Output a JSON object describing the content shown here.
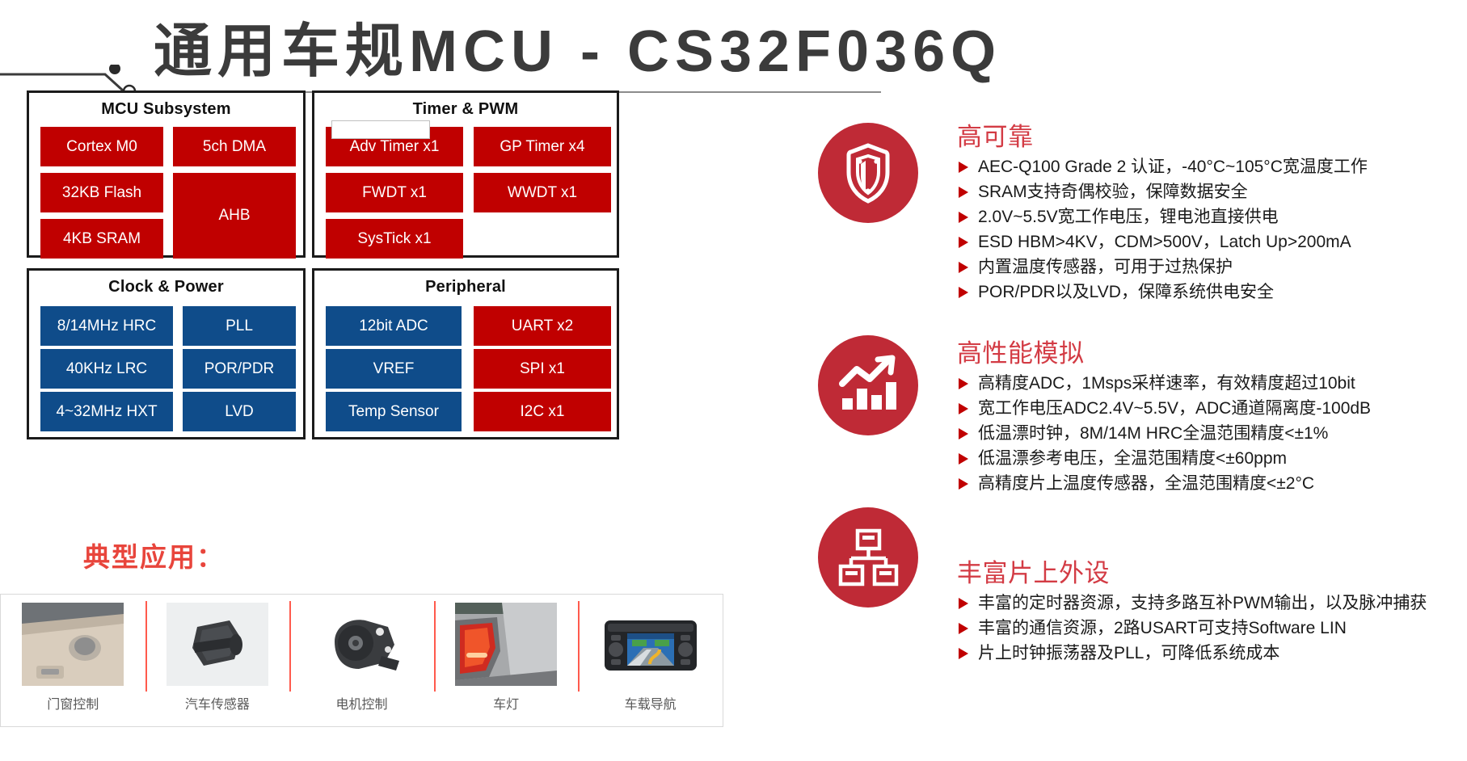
{
  "title": "通用车规MCU - CS32F036Q",
  "colors": {
    "red": "#c00000",
    "blue": "#0f4c8a",
    "heading_red": "#d33b44",
    "apps_heading_red": "#e8453c",
    "icon_circle": "#bf2a36"
  },
  "diagram": {
    "blocks": [
      {
        "id": "mcu-subsystem",
        "title": "MCU Subsystem",
        "cells": [
          {
            "label": "Cortex M0",
            "color": "red",
            "span": 1,
            "rows": 1
          },
          {
            "label": "5ch DMA",
            "color": "red",
            "span": 1,
            "rows": 1
          },
          {
            "label": "32KB Flash",
            "color": "red",
            "span": 1,
            "rows": 1
          },
          {
            "label": "AHB",
            "color": "red",
            "span": 1,
            "rows": 2
          },
          {
            "label": "4KB SRAM",
            "color": "red",
            "span": 1,
            "rows": 1
          }
        ]
      },
      {
        "id": "timer-pwm",
        "title": "Timer & PWM",
        "cells": [
          {
            "label": "Adv Timer x1",
            "color": "red",
            "span": 1,
            "rows": 1
          },
          {
            "label": "GP Timer x4",
            "color": "red",
            "span": 1,
            "rows": 1
          },
          {
            "label": "FWDT x1",
            "color": "red",
            "span": 1,
            "rows": 1
          },
          {
            "label": "WWDT x1",
            "color": "red",
            "span": 1,
            "rows": 1
          },
          {
            "label": "SysTick x1",
            "color": "red",
            "span": 1,
            "rows": 1
          },
          {
            "label": "",
            "color": "empty",
            "span": 1,
            "rows": 1
          }
        ]
      },
      {
        "id": "clock-power",
        "title": "Clock & Power",
        "cells": [
          {
            "label": "8/14MHz HRC",
            "color": "blue",
            "span": 1,
            "rows": 1
          },
          {
            "label": "PLL",
            "color": "blue",
            "span": 1,
            "rows": 1
          },
          {
            "label": "40KHz LRC",
            "color": "blue",
            "span": 1,
            "rows": 1
          },
          {
            "label": "POR/PDR",
            "color": "blue",
            "span": 1,
            "rows": 1
          },
          {
            "label": "4~32MHz HXT",
            "color": "blue",
            "span": 1,
            "rows": 1
          },
          {
            "label": "LVD",
            "color": "blue",
            "span": 1,
            "rows": 1
          }
        ]
      },
      {
        "id": "peripheral",
        "title": "Peripheral",
        "cells": [
          {
            "label": "12bit ADC",
            "color": "blue",
            "span": 1,
            "rows": 1
          },
          {
            "label": "UART x2",
            "color": "red",
            "span": 1,
            "rows": 1
          },
          {
            "label": "VREF",
            "color": "blue",
            "span": 1,
            "rows": 1
          },
          {
            "label": "SPI x1",
            "color": "red",
            "span": 1,
            "rows": 1
          },
          {
            "label": "Temp Sensor",
            "color": "blue",
            "span": 1,
            "rows": 1
          },
          {
            "label": "I2C x1",
            "color": "red",
            "span": 1,
            "rows": 1
          }
        ]
      }
    ]
  },
  "applications": {
    "heading": "典型应用：",
    "items": [
      {
        "label": "门窗控制",
        "thumb": "door-window-control-photo"
      },
      {
        "label": "汽车传感器",
        "thumb": "automotive-sensor-photo"
      },
      {
        "label": "电机控制",
        "thumb": "motor-control-photo"
      },
      {
        "label": "车灯",
        "thumb": "car-lamp-photo"
      },
      {
        "label": "车载导航",
        "thumb": "car-navigation-photo"
      }
    ]
  },
  "features": [
    {
      "id": "high-reliability",
      "icon": "shield-icon",
      "heading": "高可靠",
      "bullets": [
        "AEC-Q100 Grade 2 认证，-40°C~105°C宽温度工作",
        "SRAM支持奇偶校验，保障数据安全",
        "2.0V~5.5V宽工作电压，锂电池直接供电",
        "ESD HBM>4KV，CDM>500V，Latch Up>200mA",
        "内置温度传感器，可用于过热保护",
        "POR/PDR以及LVD，保障系统供电安全"
      ]
    },
    {
      "id": "high-performance-analog",
      "icon": "chart-bars-icon",
      "heading": "高性能模拟",
      "bullets": [
        "高精度ADC，1Msps采样速率，有效精度超过10bit",
        "宽工作电压ADC2.4V~5.5V，ADC通道隔离度-100dB",
        "低温漂时钟，8M/14M HRC全温范围精度<±1%",
        "低温漂参考电压，全温范围精度<±60ppm",
        "高精度片上温度传感器，全温范围精度<±2°C"
      ]
    },
    {
      "id": "rich-on-chip-peripherals",
      "icon": "hierarchy-blocks-icon",
      "heading": "丰富片上外设",
      "bullets": [
        "丰富的定时器资源，支持多路互补PWM输出，以及脉冲捕获",
        "丰富的通信资源，2路USART可支持Software LIN",
        "片上时钟振荡器及PLL，可降低系统成本"
      ]
    }
  ]
}
